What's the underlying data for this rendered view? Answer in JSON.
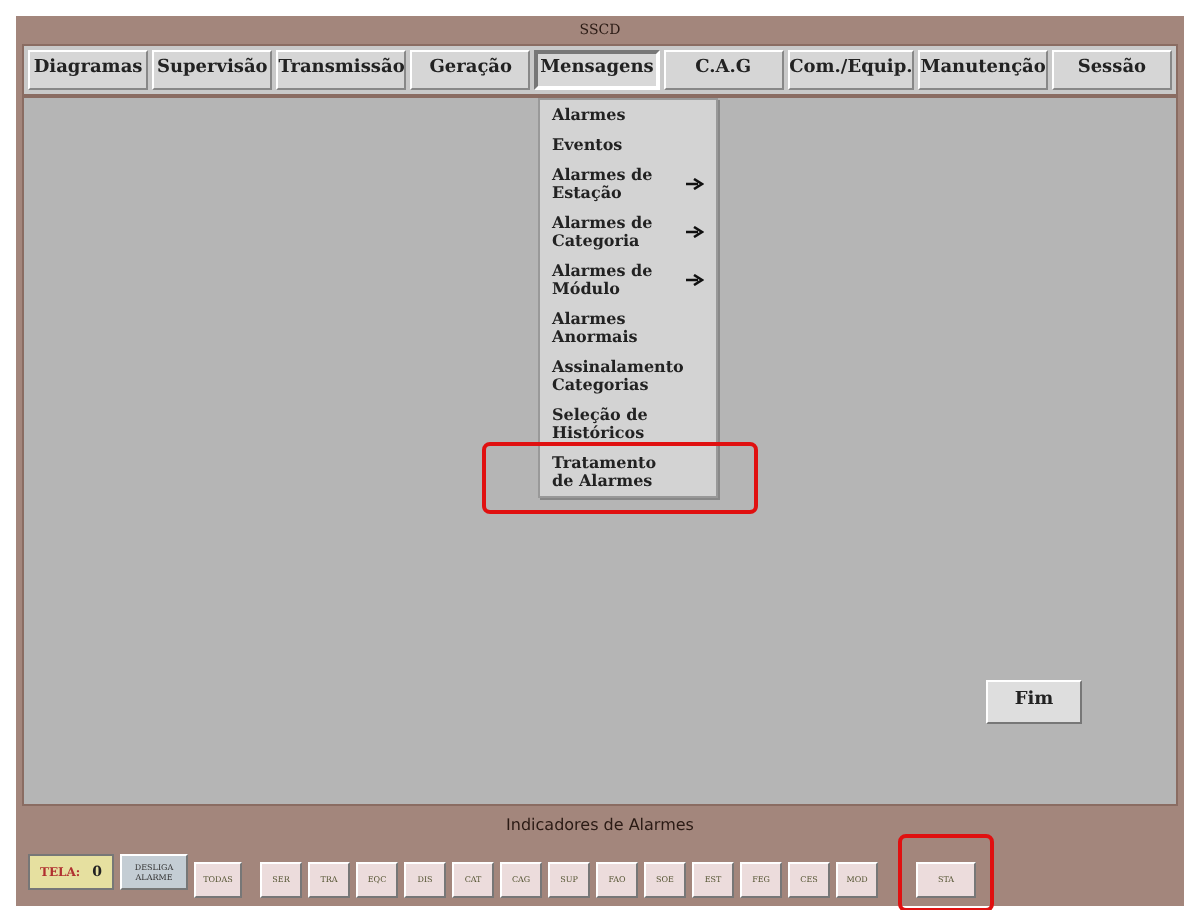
{
  "window": {
    "title": "SSCD"
  },
  "menu_bar": [
    {
      "label": "Diagramas",
      "selected": false
    },
    {
      "label": "Supervisão",
      "selected": false
    },
    {
      "label": "Transmissão",
      "selected": false
    },
    {
      "label": "Geração",
      "selected": false
    },
    {
      "label": "Mensagens",
      "selected": true
    },
    {
      "label": "C.A.G",
      "selected": false
    },
    {
      "label": "Com./Equip.",
      "selected": false
    },
    {
      "label": "Manutenção",
      "selected": false
    },
    {
      "label": "Sessão",
      "selected": false
    }
  ],
  "dropdown": [
    {
      "label": "Alarmes",
      "submenu": false,
      "highlighted": false
    },
    {
      "label": "Eventos",
      "submenu": false,
      "highlighted": false
    },
    {
      "label": "Alarmes de Estação",
      "submenu": true,
      "highlighted": false
    },
    {
      "label": "Alarmes de Categoria",
      "submenu": true,
      "highlighted": false
    },
    {
      "label": "Alarmes de Módulo",
      "submenu": true,
      "highlighted": false
    },
    {
      "label": "Alarmes Anormais",
      "submenu": false,
      "highlighted": false
    },
    {
      "label": "Assinalamento Categorias",
      "submenu": false,
      "highlighted": false
    },
    {
      "label": "Seleção de Históricos",
      "submenu": false,
      "highlighted": false
    },
    {
      "label": "Tratamento de Alarmes",
      "submenu": false,
      "highlighted": true
    }
  ],
  "fim_button": "Fim",
  "alarm_panel": {
    "title": "Indicadores de Alarmes",
    "screen_label": "TELA:",
    "screen_value": "0",
    "silence_button": "DESLIGA ALARME",
    "buttons": [
      {
        "label": "TODAS",
        "highlighted": false
      },
      {
        "label": "SER",
        "highlighted": false
      },
      {
        "label": "TRA",
        "highlighted": false
      },
      {
        "label": "EQC",
        "highlighted": false
      },
      {
        "label": "DIS",
        "highlighted": false
      },
      {
        "label": "CAT",
        "highlighted": false
      },
      {
        "label": "CAG",
        "highlighted": false
      },
      {
        "label": "SUP",
        "highlighted": false
      },
      {
        "label": "FAO",
        "highlighted": false
      },
      {
        "label": "SOE",
        "highlighted": false
      },
      {
        "label": "EST",
        "highlighted": false
      },
      {
        "label": "FEG",
        "highlighted": false
      },
      {
        "label": "CES",
        "highlighted": false
      },
      {
        "label": "MOD",
        "highlighted": false
      },
      {
        "label": "STA",
        "highlighted": true
      }
    ]
  }
}
